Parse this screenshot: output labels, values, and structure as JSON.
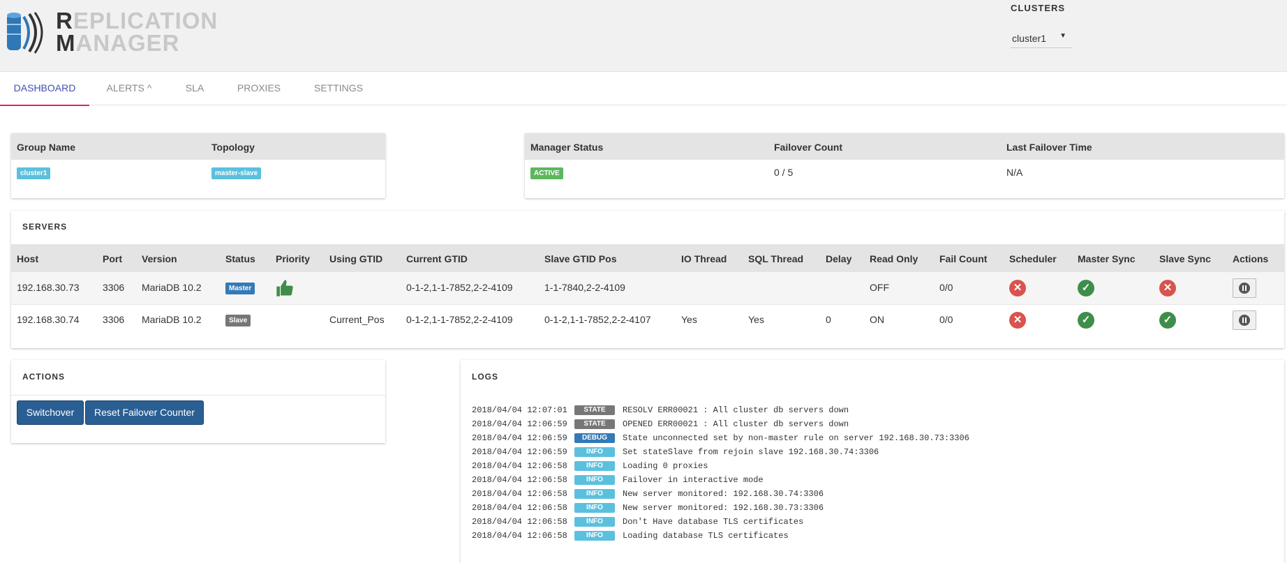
{
  "app": {
    "logo_line1_first": "R",
    "logo_line1_rest": "EPLICATION",
    "logo_line2_first": "M",
    "logo_line2_rest": "ANAGER"
  },
  "clusters": {
    "label": "CLUSTERS",
    "selected": "cluster1"
  },
  "tabs": [
    {
      "label": "DASHBOARD",
      "active": true
    },
    {
      "label": "ALERTS ^",
      "active": false
    },
    {
      "label": "SLA",
      "active": false
    },
    {
      "label": "PROXIES",
      "active": false
    },
    {
      "label": "SETTINGS",
      "active": false
    }
  ],
  "group_card": {
    "headers": [
      "Group Name",
      "Topology"
    ],
    "group_name": "cluster1",
    "topology": "master-slave"
  },
  "manager_card": {
    "headers": [
      "Manager Status",
      "Failover Count",
      "Last Failover Time"
    ],
    "status": "ACTIVE",
    "failover_count": "0 / 5",
    "last_failover_time": "N/A"
  },
  "servers": {
    "title": "SERVERS",
    "headers": [
      "Host",
      "Port",
      "Version",
      "Status",
      "Priority",
      "Using GTID",
      "Current GTID",
      "Slave GTID Pos",
      "IO Thread",
      "SQL Thread",
      "Delay",
      "Read Only",
      "Fail Count",
      "Scheduler",
      "Master Sync",
      "Slave Sync",
      "Actions"
    ],
    "rows": [
      {
        "host": "192.168.30.73",
        "port": "3306",
        "version": "MariaDB 10.2",
        "status": "Master",
        "status_color": "#337ab7",
        "priority_icon": "thumbs-up-icon",
        "using_gtid": "",
        "current_gtid": "0-1-2,1-1-7852,2-2-4109",
        "slave_gtid_pos": "1-1-7840,2-2-4109",
        "io_thread": "",
        "sql_thread": "",
        "delay": "",
        "read_only": "OFF",
        "fail_count": "0/0",
        "scheduler": "x-circle-icon",
        "master_sync": "check-circle-icon",
        "slave_sync": "x-circle-icon"
      },
      {
        "host": "192.168.30.74",
        "port": "3306",
        "version": "MariaDB 10.2",
        "status": "Slave",
        "status_color": "#777777",
        "priority_icon": "",
        "using_gtid": "Current_Pos",
        "current_gtid": "0-1-2,1-1-7852,2-2-4109",
        "slave_gtid_pos": "0-1-2,1-1-7852,2-2-4107",
        "io_thread": "Yes",
        "sql_thread": "Yes",
        "delay": "0",
        "read_only": "ON",
        "fail_count": "0/0",
        "scheduler": "x-circle-icon",
        "master_sync": "check-circle-icon",
        "slave_sync": "check-circle-icon"
      }
    ]
  },
  "actions": {
    "title": "ACTIONS",
    "switchover_label": "Switchover",
    "reset_label": "Reset Failover Counter"
  },
  "logs": {
    "title": "LOGS",
    "entries": [
      {
        "time": "2018/04/04 12:07:01",
        "level": "STATE",
        "color": "#777777",
        "msg": "RESOLV ERR00021 : All cluster db servers down"
      },
      {
        "time": "2018/04/04 12:06:59",
        "level": "STATE",
        "color": "#777777",
        "msg": "OPENED ERR00021 : All cluster db servers down"
      },
      {
        "time": "2018/04/04 12:06:59",
        "level": "DEBUG",
        "color": "#337ab7",
        "msg": "State unconnected set by non-master rule on server 192.168.30.73:3306"
      },
      {
        "time": "2018/04/04 12:06:59",
        "level": "INFO",
        "color": "#5bc0de",
        "msg": "Set stateSlave from rejoin slave 192.168.30.74:3306"
      },
      {
        "time": "2018/04/04 12:06:58",
        "level": "INFO",
        "color": "#5bc0de",
        "msg": "Loading 0 proxies"
      },
      {
        "time": "2018/04/04 12:06:58",
        "level": "INFO",
        "color": "#5bc0de",
        "msg": "Failover in interactive mode"
      },
      {
        "time": "2018/04/04 12:06:58",
        "level": "INFO",
        "color": "#5bc0de",
        "msg": "New server monitored: 192.168.30.74:3306"
      },
      {
        "time": "2018/04/04 12:06:58",
        "level": "INFO",
        "color": "#5bc0de",
        "msg": "New server monitored: 192.168.30.73:3306"
      },
      {
        "time": "2018/04/04 12:06:58",
        "level": "INFO",
        "color": "#5bc0de",
        "msg": "Don't Have database TLS certificates"
      },
      {
        "time": "2018/04/04 12:06:58",
        "level": "INFO",
        "color": "#5bc0de",
        "msg": "Loading database TLS certificates"
      }
    ]
  },
  "colors": {
    "accent": "#3f51b5",
    "tab_indicator": "#e91e63",
    "info_badge": "#5bc0de",
    "active_badge": "#5cb85c",
    "button": "#2a5f93"
  }
}
